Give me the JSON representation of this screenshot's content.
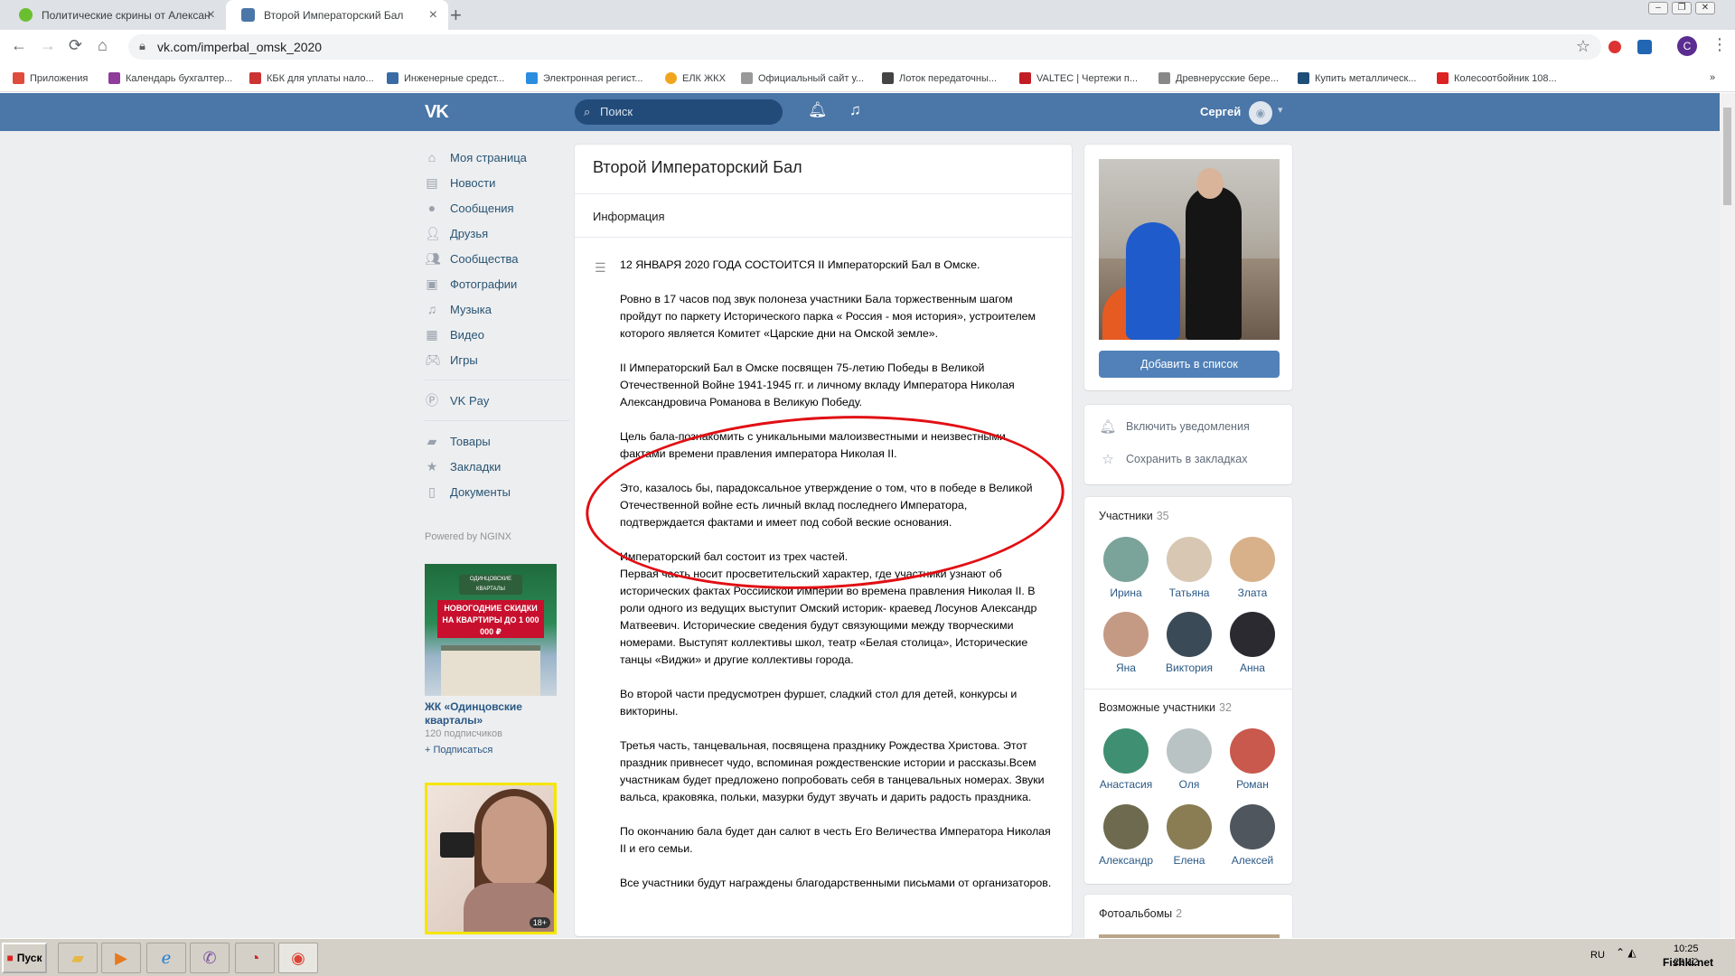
{
  "browser": {
    "tabs": [
      {
        "label": "Политические скрины от Алексан",
        "favicon_color": "#6abf2e"
      },
      {
        "label": "Второй Императорский Бал",
        "favicon_color": "#4a76a8"
      }
    ],
    "new_tab": "+",
    "url": "vk.com/imperbal_omsk_2020",
    "avatar_letter": "С",
    "bookmarks": [
      "Приложения",
      "Календарь бухгалтер...",
      "КБК для уплаты нало...",
      "Инженерные средст...",
      "Электронная регист...",
      "ЕЛК ЖКХ",
      "Официальный сайт у...",
      "Лоток передаточны...",
      "VALTEC | Чертежи п...",
      "Древнерусские бере...",
      "Купить металлическ...",
      "Колесоотбойник 108..."
    ]
  },
  "vk_header": {
    "logo": "VK",
    "search_placeholder": "Поиск",
    "username": "Сергей",
    "accent": "#4a76a8"
  },
  "left_menu": {
    "items": [
      {
        "label": "Моя страница",
        "icon": "home-icon"
      },
      {
        "label": "Новости",
        "icon": "news-icon"
      },
      {
        "label": "Сообщения",
        "icon": "messages-icon"
      },
      {
        "label": "Друзья",
        "icon": "friends-icon"
      },
      {
        "label": "Сообщества",
        "icon": "groups-icon"
      },
      {
        "label": "Фотографии",
        "icon": "photos-icon"
      },
      {
        "label": "Музыка",
        "icon": "music-icon"
      },
      {
        "label": "Видео",
        "icon": "video-icon"
      },
      {
        "label": "Игры",
        "icon": "games-icon"
      }
    ],
    "vkpay": "VK Pay",
    "items2": [
      {
        "label": "Товары",
        "icon": "goods-icon"
      },
      {
        "label": "Закладки",
        "icon": "bookmarks-icon"
      },
      {
        "label": "Документы",
        "icon": "documents-icon"
      }
    ],
    "powered": "Powered by NGINX"
  },
  "ads": {
    "ad1_badge": "ОДИНЦОВСКИЕ КВАРТАЛЫ",
    "ad1_promo": "НОВОГОДНИЕ СКИДКИ НА КВАРТИРЫ ДО 1 000 000 ₽",
    "ad1_title": "ЖК «Одинцовские кварталы»",
    "ad1_subs": "120 подписчиков",
    "ad1_subscribe": "+ Подписаться",
    "ad2_age": "18+"
  },
  "main": {
    "title": "Второй Императорский Бал",
    "info_label": "Информация",
    "paragraphs": [
      "12 ЯНВАРЯ 2020 ГОДА СОСТОИТСЯ II Императорский Бал в Омске.",
      "Ровно в 17 часов под звук полонеза участники Бала торжественным шагом пройдут по паркету Исторического парка « Россия - моя история», устроителем которого является Комитет «Царские дни на Омской земле».",
      "II Императорский Бал в Омске посвящен 75-летию Победы в Великой Отечественной Войне 1941-1945 гг. и личному вкладу Императора Николая Александровича Романова в Великую Победу.",
      "Цель бала-познакомить с уникальными малоизвестными и неизвестными фактами времени правления императора Николая II.",
      "Это, казалось бы, парадоксальное утверждение о том, что в победе в Великой Отечественной войне есть личный вклад последнего Императора, подтверждается фактами и имеет под собой веские основания.",
      "Императорский бал состоит из трех частей.",
      "Первая часть носит просветительский характер, где участники узнают об исторических фактах Российской Империи во времена правления Николая II. В роли одного из ведущих выступит Омский историк- краевед Лосунов Александр Матвеевич. Исторические сведения будут связующими между творческими номерами. Выступят коллективы школ, театр «Белая столица», Исторические танцы «Виджи» и другие коллективы города.",
      "Во второй части предусмотрен фуршет, сладкий стол для детей, конкурсы и викторины.",
      "Третья часть, танцевальная, посвящена празднику Рождества Христова. Этот праздник привнесет чудо, вспоминая рождественские истории и рассказы.Всем участникам будет предложено попробовать себя в танцевальных номерах. Звуки вальса, краковяка, польки, мазурки будут звучать и дарить радость праздника.",
      "По окончанию бала будет дан салют в честь Его Величества Императора Николая II и его семьи.",
      "Все участники будут награждены благодарственными письмами от организаторов."
    ]
  },
  "side": {
    "add_button": "Добавить в список",
    "enable_notifications": "Включить уведомления",
    "save_bookmarks": "Сохранить в закладках",
    "members_label": "Участники",
    "members_count": "35",
    "members": [
      {
        "name": "Ирина",
        "color": "#7aa39a"
      },
      {
        "name": "Татьяна",
        "color": "#d7c7b3"
      },
      {
        "name": "Злата",
        "color": "#d8b18a"
      },
      {
        "name": "Яна",
        "color": "#c49a84"
      },
      {
        "name": "Виктория",
        "color": "#3b4a57"
      },
      {
        "name": "Анна",
        "color": "#2a2a30"
      }
    ],
    "possible_label": "Возможные участники",
    "possible_count": "32",
    "possible": [
      {
        "name": "Анастасия",
        "color": "#3f8f73"
      },
      {
        "name": "Оля",
        "color": "#b9c3c4"
      },
      {
        "name": "Роман",
        "color": "#c9584d"
      },
      {
        "name": "Александр",
        "color": "#6e6a4f"
      },
      {
        "name": "Елена",
        "color": "#8a7d54"
      },
      {
        "name": "Алексей",
        "color": "#50565e"
      }
    ],
    "albums_label": "Фотоальбомы",
    "albums_count": "2"
  },
  "taskbar": {
    "start": "Пуск",
    "lang": "RU",
    "time": "10:25",
    "date": "22.12"
  },
  "watermark": "Fishki.net"
}
